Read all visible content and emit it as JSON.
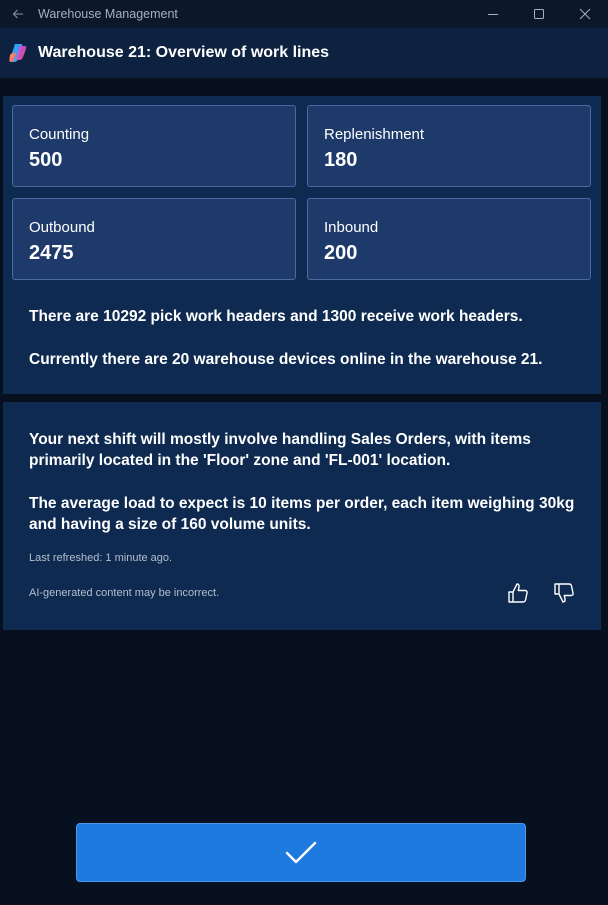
{
  "window": {
    "title": "Warehouse Management"
  },
  "header": {
    "title": "Warehouse 21: Overview of work lines"
  },
  "summary": {
    "tiles": [
      {
        "label": "Counting",
        "value": "500"
      },
      {
        "label": "Replenishment",
        "value": "180"
      },
      {
        "label": "Outbound",
        "value": "2475"
      },
      {
        "label": "Inbound",
        "value": "200"
      }
    ],
    "headers_text": "There are 10292 pick work headers and 1300 receive work headers.",
    "devices_text": "Currently there are 20 warehouse devices online in the warehouse 21."
  },
  "ai_insight": {
    "shift_text": "Your next shift will mostly involve handling Sales Orders, with items primarily located in the 'Floor' zone and 'FL-001' location.",
    "load_text": "The average load to expect is 10 items per order, each item weighing 30kg and having a size of 160 volume units.",
    "refreshed": "Last refreshed: 1 minute ago.",
    "disclaimer": "AI-generated content may be incorrect."
  },
  "icons": {
    "back": "back-arrow-icon",
    "minimize": "minimize-icon",
    "maximize": "maximize-icon",
    "close": "close-icon",
    "logo": "copilot-logo-icon",
    "thumbs_up": "thumbs-up-icon",
    "thumbs_down": "thumbs-down-icon",
    "confirm": "checkmark-icon"
  },
  "colors": {
    "background": "#06101f",
    "panel": "#0e2a51",
    "tile": "#1d3a6a",
    "accent": "#1f7ae0"
  }
}
